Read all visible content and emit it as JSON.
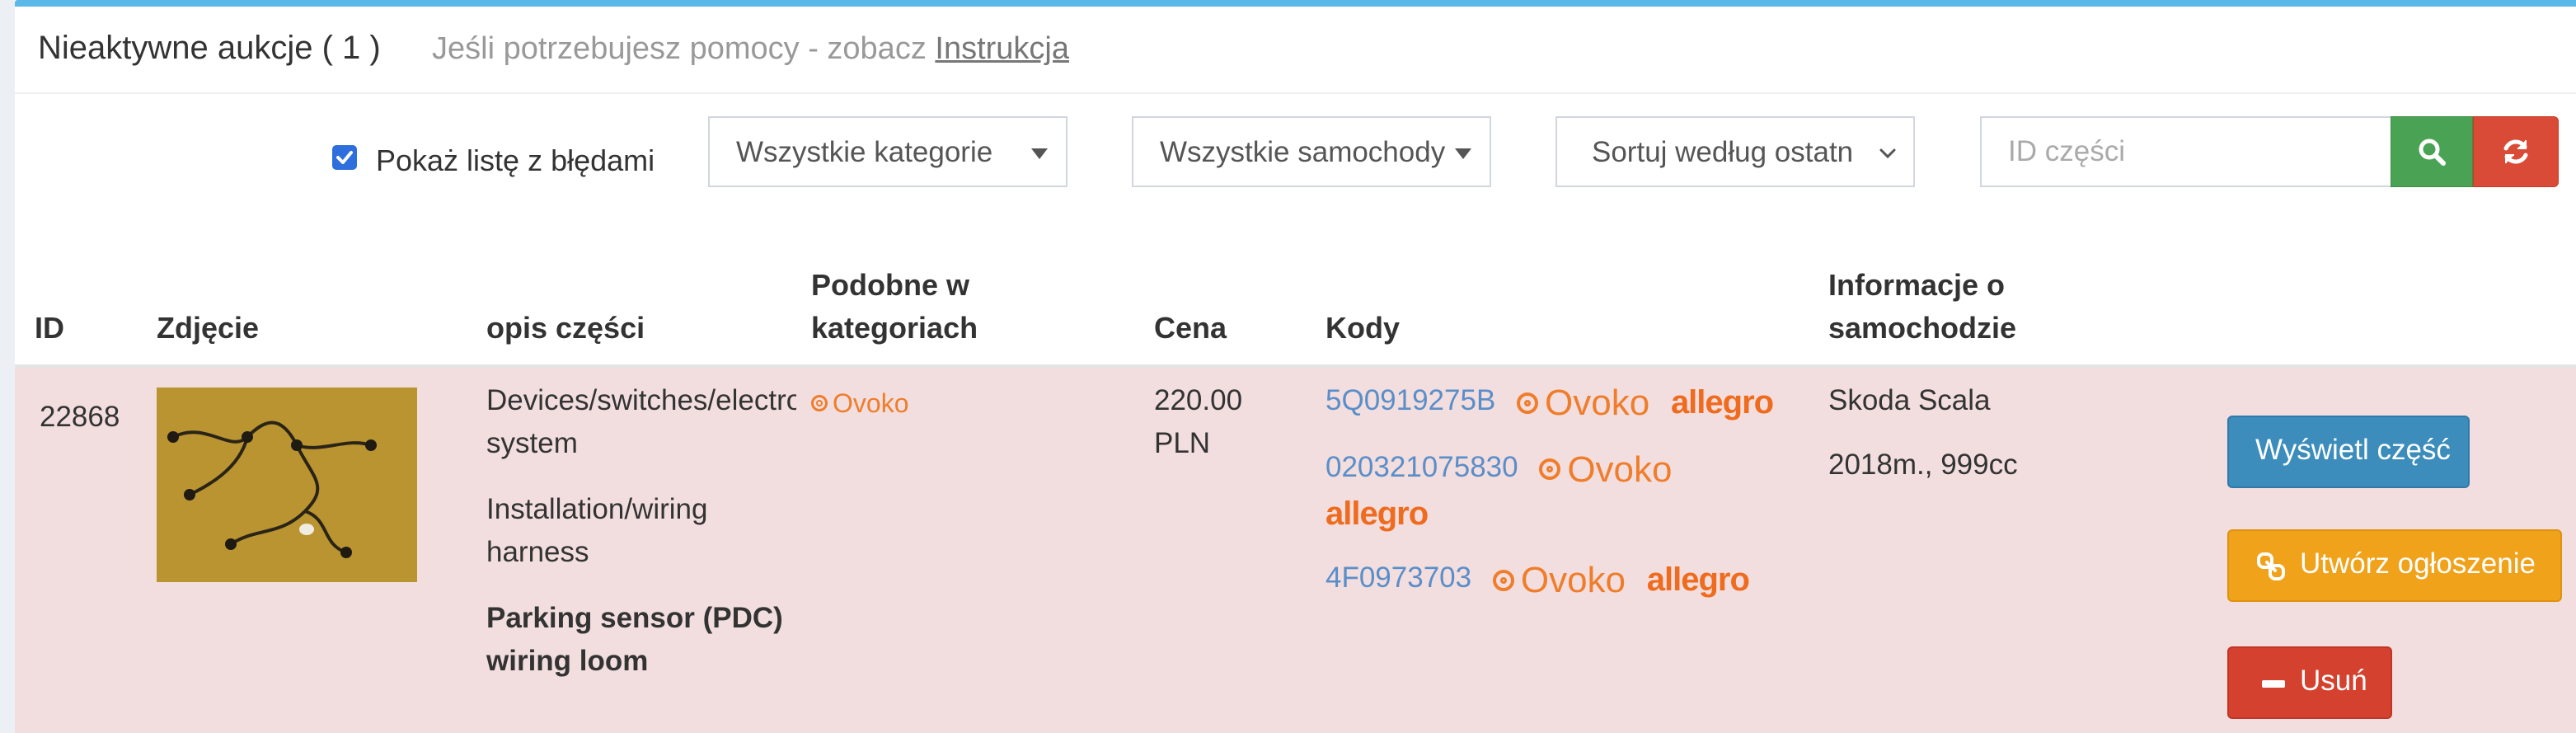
{
  "header": {
    "title": "Nieaktywne aukcje ( 1 )",
    "help_text": "Jeśli potrzebujesz pomocy - zobacz",
    "help_link": "Instrukcja"
  },
  "filters": {
    "show_errors_label": "Pokaż listę z błędami",
    "show_errors_checked": true,
    "category_select": "Wszystkie kategorie",
    "cars_select": "Wszystkie samochody",
    "sort_select": "Sortuj według ostatn",
    "id_placeholder": "ID części",
    "search_icon": "search-icon",
    "refresh_icon": "refresh-icon"
  },
  "table": {
    "headers": {
      "id": "ID",
      "photo": "Zdjęcie",
      "description": "opis części",
      "similar_1": "Podobne w",
      "similar_2": "kategoriach",
      "price": "Cena",
      "codes": "Kody",
      "car_info_1": "Informacje o",
      "car_info_2": "samochodzie"
    },
    "row": {
      "id": "22868",
      "desc_line1": "Devices/switches/electro",
      "desc_line2": "system",
      "desc_line3": "Installation/wiring",
      "desc_line4": "harness",
      "desc_bold1": "Parking sensor (PDC)",
      "desc_bold2": "wiring loom",
      "similar": "Ovoko",
      "price_value": "220.00",
      "price_currency": "PLN",
      "codes": [
        {
          "code": "5Q0919275B",
          "ovoko": "Ovoko",
          "allegro": "allegro"
        },
        {
          "code": "020321075830",
          "ovoko": "Ovoko",
          "allegro": "allegro"
        },
        {
          "code": "4F0973703",
          "ovoko": "Ovoko",
          "allegro": "allegro"
        }
      ],
      "car_model": "Skoda Scala",
      "car_details": "2018m., 999cc"
    },
    "actions": {
      "view": "Wyświetl część",
      "create": "Utwórz ogłoszenie",
      "delete": "Usuń"
    }
  },
  "colors": {
    "accent_top": "#5ab9e8",
    "row_error_bg": "#f2dede",
    "code_link": "#5b8ec9",
    "ovoko": "#ef7d2b",
    "allegro": "#ef6b1e",
    "btn_view": "#3c8dbc",
    "btn_create": "#f0a21a",
    "btn_delete": "#d5412f",
    "btn_search": "#4aa354",
    "btn_refresh": "#d94b36"
  }
}
